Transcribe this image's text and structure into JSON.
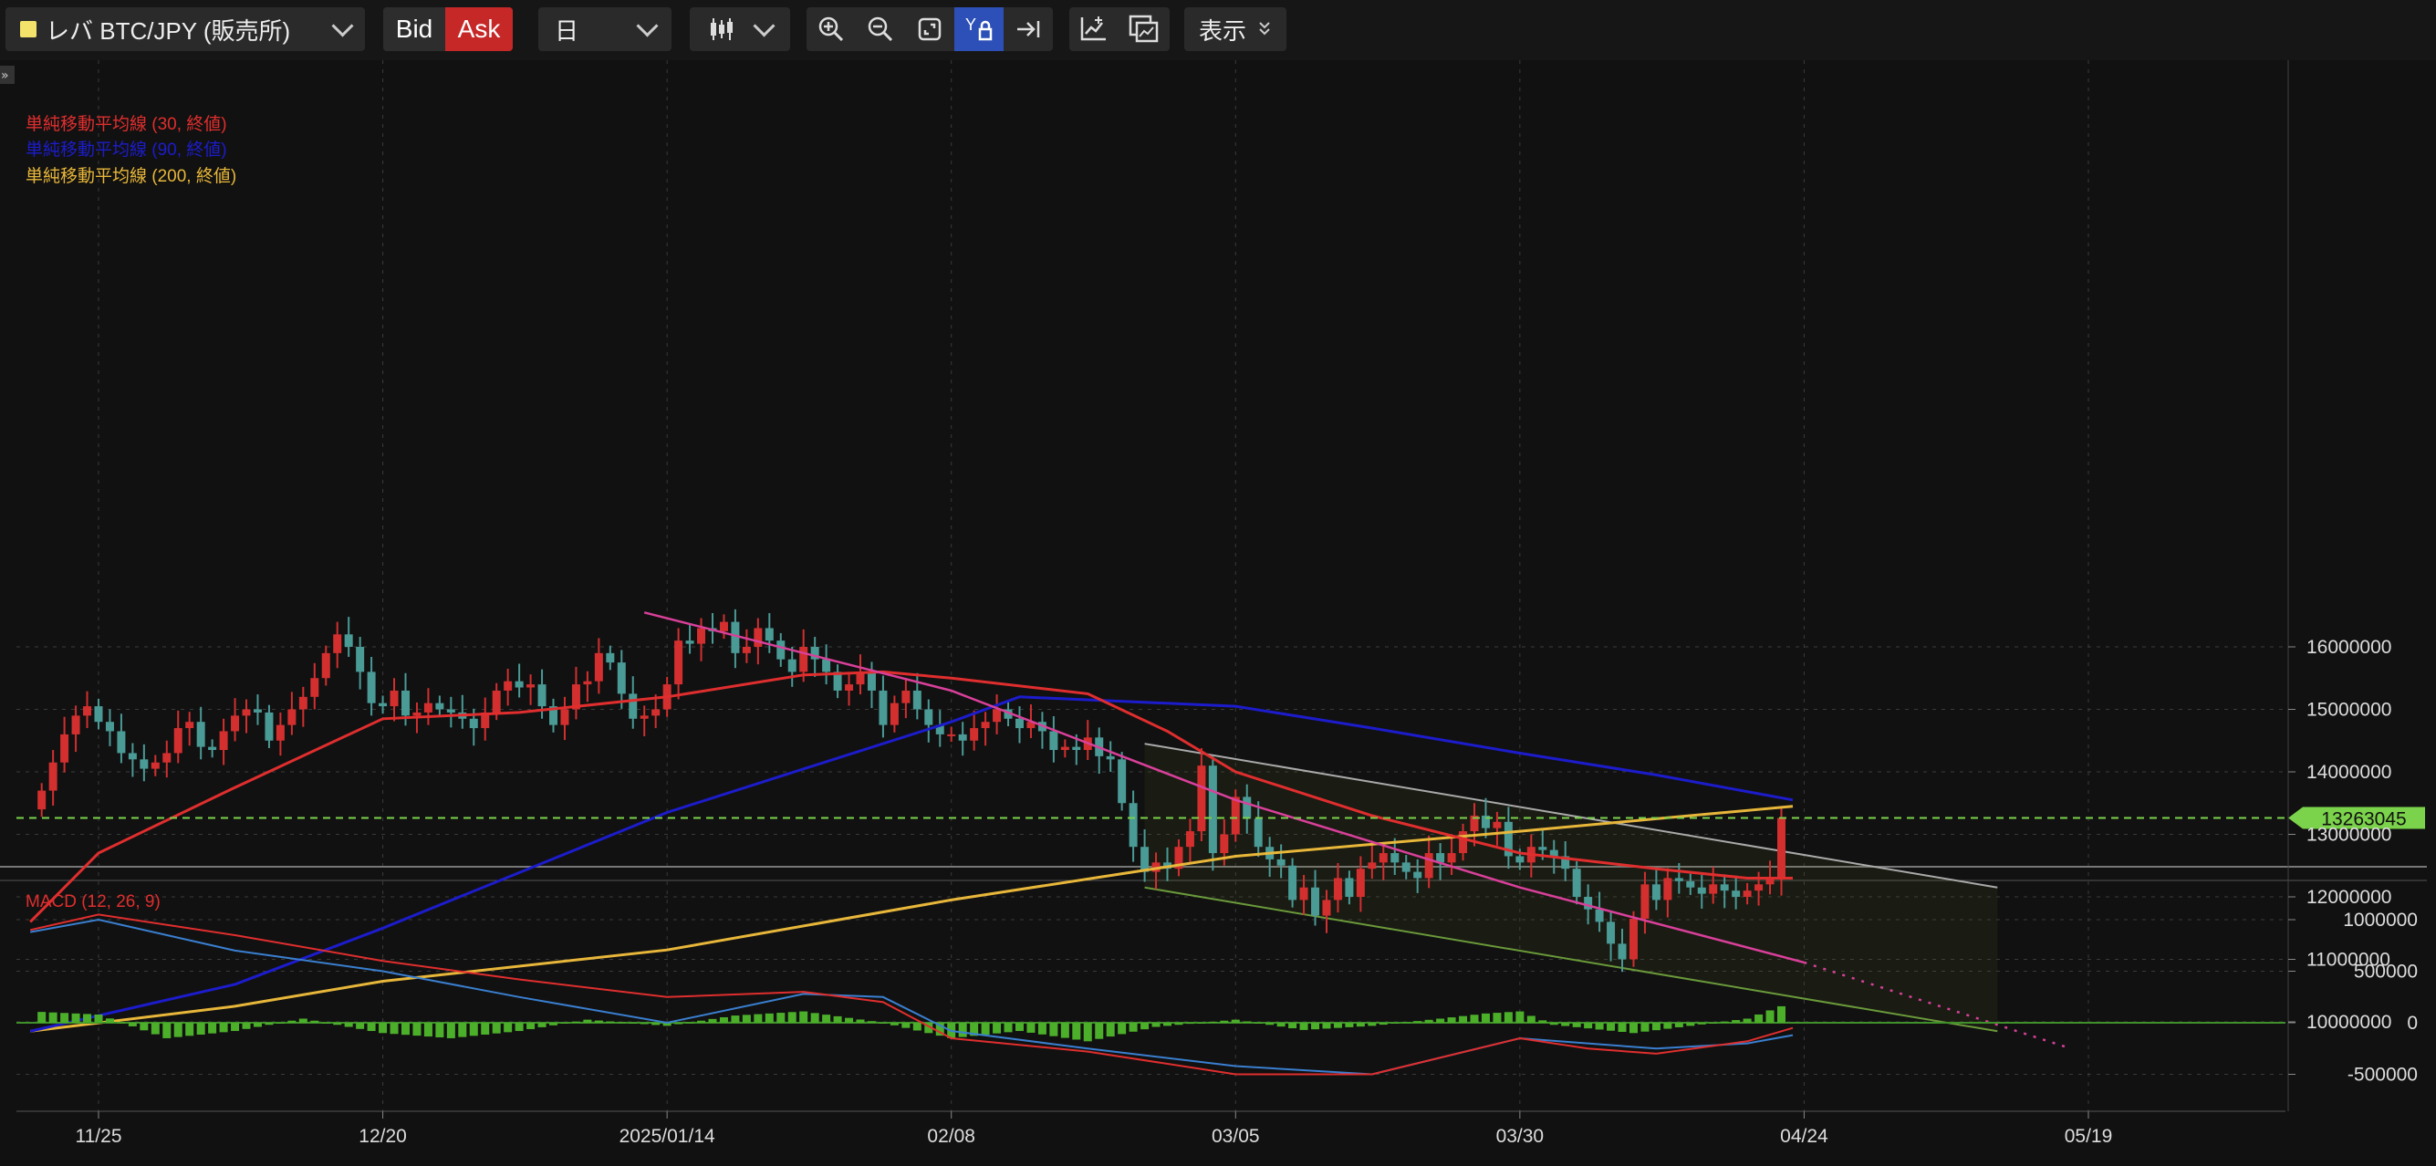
{
  "toolbar": {
    "symbol": "レバ BTC/JPY (販売所)",
    "symbol_color": "#f4e36b",
    "bid_label": "Bid",
    "ask_label": "Ask",
    "period": "日",
    "view_label": "表示",
    "tools": [
      "zoom-in-icon",
      "zoom-out-icon",
      "fit-icon",
      "y-lock-icon",
      "scroll-end-icon"
    ],
    "draw_tools": [
      "add-indicator-icon",
      "compare-icon"
    ]
  },
  "legend": {
    "sma30": "単純移動平均線 (30, 終値)",
    "sma90": "単純移動平均線 (90, 終値)",
    "sma200": "単純移動平均線 (200, 終値)",
    "macd": "MACD (12, 26, 9)"
  },
  "chart_data": {
    "type": "candlestick",
    "price_axis_ticks": [
      "16000000",
      "15000000",
      "14000000",
      "13000000",
      "12000000",
      "11000000",
      "10000000"
    ],
    "macd_axis_ticks": [
      "1000000",
      "500000",
      "0",
      "-500000"
    ],
    "x_ticks": [
      "11/25",
      "12/20",
      "2025/01/14",
      "02/08",
      "03/05",
      "03/30",
      "04/24",
      "05/19"
    ],
    "current_price": "13263045",
    "colors": {
      "up": "#d32f2f",
      "down": "#4a9a96",
      "sma30": "#e02e2e",
      "sma90": "#1c1ccc",
      "sma200": "#e8b73a",
      "trend": "#d9409a",
      "channel_top": "#aaaaaa",
      "channel_bottom": "#6a9a3a",
      "price_line": "#7bd24b",
      "macd": "#e02e2e",
      "signal": "#3a7fd0",
      "hist": "#4caf2a"
    },
    "anchors": {
      "11/25": 0,
      "12/20": 25,
      "2025/01/14": 50,
      "02/08": 75,
      "03/05": 100,
      "03/30": 125,
      "04/24": 150,
      "05/19": 175
    },
    "candles": {
      "start": "11/20",
      "end": "04/23",
      "close": [
        13700000,
        14150000,
        14600000,
        14900000,
        15050000,
        14800000,
        14650000,
        14300000,
        14200000,
        14050000,
        14150000,
        14300000,
        14700000,
        14800000,
        14400000,
        14350000,
        14650000,
        14900000,
        15000000,
        14950000,
        14500000,
        14750000,
        15000000,
        15200000,
        15500000,
        15900000,
        16200000,
        16000000,
        15600000,
        15100000,
        15050000,
        15300000,
        14900000,
        14950000,
        15100000,
        15000000,
        14950000,
        14850000,
        14700000,
        14950000,
        15300000,
        15450000,
        15350000,
        15400000,
        15050000,
        14750000,
        15000000,
        15400000,
        15450000,
        15900000,
        15750000,
        15250000,
        14850000,
        14900000,
        15000000,
        15400000,
        16100000,
        16050000,
        16300000,
        16250000,
        16400000,
        15900000,
        16000000,
        16300000,
        16100000,
        15800000,
        15600000,
        16000000,
        15800000,
        15600000,
        15300000,
        15400000,
        15600000,
        15300000,
        14750000,
        15100000,
        15300000,
        15000000,
        14750000,
        14600000,
        14600000,
        14500000,
        14700000,
        14800000,
        15000000,
        14850000,
        14700000,
        14800000,
        14650000,
        14350000,
        14400000,
        14350000,
        14550000,
        14250000,
        14200000,
        13500000,
        12800000,
        12400000,
        12550000,
        12450000,
        12800000,
        13050000,
        14100000,
        12700000,
        13000000,
        13600000,
        13250000,
        12800000,
        12600000,
        12500000,
        11950000,
        12150000,
        11700000,
        11950000,
        12300000,
        12000000,
        12450000,
        12550000,
        12700000,
        12550000,
        12400000,
        12300000,
        12700000,
        12550000,
        12700000,
        13050000,
        13300000,
        13100000,
        13200000,
        12650000,
        12550000,
        12800000,
        12750000,
        12650000,
        12450000,
        12000000,
        11800000,
        11600000,
        11250000,
        11000000,
        11650000,
        12200000,
        11950000,
        12300000,
        12250000,
        12150000,
        12050000,
        12200000,
        12100000,
        12000000,
        12100000,
        12200000,
        12300000,
        13263045
      ]
    },
    "sma30": [
      [
        -6,
        11600000
      ],
      [
        0,
        12700000
      ],
      [
        12,
        13750000
      ],
      [
        25,
        14850000
      ],
      [
        37,
        14950000
      ],
      [
        50,
        15200000
      ],
      [
        62,
        15550000
      ],
      [
        69,
        15600000
      ],
      [
        75,
        15500000
      ],
      [
        87,
        15250000
      ],
      [
        94,
        14650000
      ],
      [
        100,
        14000000
      ],
      [
        112,
        13300000
      ],
      [
        125,
        12700000
      ],
      [
        137,
        12450000
      ],
      [
        145,
        12300000
      ],
      [
        149,
        12300000
      ]
    ],
    "sma90": [
      [
        -6,
        9850000
      ],
      [
        12,
        10600000
      ],
      [
        25,
        11500000
      ],
      [
        50,
        13350000
      ],
      [
        75,
        14800000
      ],
      [
        81,
        15200000
      ],
      [
        100,
        15050000
      ],
      [
        112,
        14700000
      ],
      [
        125,
        14300000
      ],
      [
        137,
        13950000
      ],
      [
        149,
        13550000
      ]
    ],
    "sma200": [
      [
        -6,
        9850000
      ],
      [
        12,
        10250000
      ],
      [
        25,
        10650000
      ],
      [
        50,
        11150000
      ],
      [
        75,
        11950000
      ],
      [
        100,
        12650000
      ],
      [
        125,
        13050000
      ],
      [
        137,
        13250000
      ],
      [
        149,
        13450000
      ]
    ],
    "trendline": [
      [
        48,
        16550000
      ],
      [
        75,
        15300000
      ],
      [
        100,
        13550000
      ],
      [
        125,
        12150000
      ],
      [
        150,
        10950000
      ]
    ],
    "trendline_ext": [
      [
        150,
        10950000
      ],
      [
        173,
        9600000
      ]
    ],
    "channel_top": [
      [
        92,
        14450000
      ],
      [
        167,
        12150000
      ]
    ],
    "channel_bottom": [
      [
        92,
        12150000
      ],
      [
        167,
        9850000
      ]
    ],
    "macd": [
      [
        -6,
        900000
      ],
      [
        0,
        1050000
      ],
      [
        12,
        850000
      ],
      [
        25,
        600000
      ],
      [
        37,
        420000
      ],
      [
        50,
        250000
      ],
      [
        62,
        300000
      ],
      [
        69,
        200000
      ],
      [
        75,
        -150000
      ],
      [
        87,
        -280000
      ],
      [
        100,
        -500000
      ],
      [
        112,
        -500000
      ],
      [
        125,
        -150000
      ],
      [
        131,
        -250000
      ],
      [
        137,
        -300000
      ],
      [
        145,
        -180000
      ],
      [
        149,
        -50000
      ]
    ],
    "signal": [
      [
        -6,
        880000
      ],
      [
        0,
        1000000
      ],
      [
        12,
        700000
      ],
      [
        25,
        500000
      ],
      [
        37,
        250000
      ],
      [
        50,
        0
      ],
      [
        62,
        280000
      ],
      [
        69,
        250000
      ],
      [
        75,
        -80000
      ],
      [
        87,
        -250000
      ],
      [
        100,
        -420000
      ],
      [
        112,
        -500000
      ],
      [
        125,
        -150000
      ],
      [
        137,
        -250000
      ],
      [
        145,
        -200000
      ],
      [
        149,
        -120000
      ]
    ],
    "histogram": [
      [
        -6,
        110000
      ],
      [
        0,
        80000
      ],
      [
        6,
        -150000
      ],
      [
        12,
        -80000
      ],
      [
        18,
        40000
      ],
      [
        25,
        -100000
      ],
      [
        31,
        -150000
      ],
      [
        37,
        -80000
      ],
      [
        43,
        30000
      ],
      [
        50,
        -30000
      ],
      [
        56,
        70000
      ],
      [
        62,
        110000
      ],
      [
        69,
        0
      ],
      [
        75,
        -150000
      ],
      [
        81,
        -80000
      ],
      [
        87,
        -180000
      ],
      [
        93,
        -40000
      ],
      [
        100,
        30000
      ],
      [
        106,
        -70000
      ],
      [
        112,
        -30000
      ],
      [
        118,
        40000
      ],
      [
        122,
        90000
      ],
      [
        125,
        110000
      ],
      [
        128,
        -20000
      ],
      [
        135,
        -100000
      ],
      [
        140,
        -30000
      ],
      [
        145,
        40000
      ],
      [
        149,
        200000
      ]
    ]
  }
}
